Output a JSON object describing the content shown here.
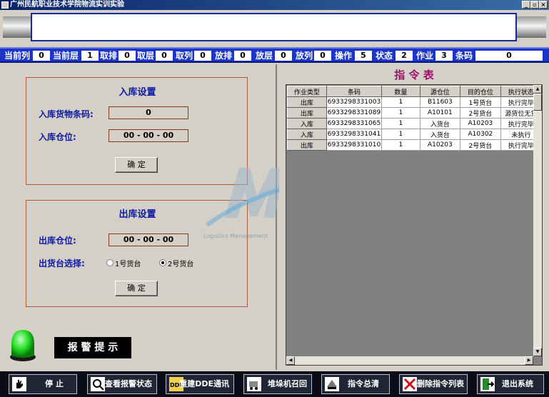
{
  "window": {
    "title": "广州民航职业技术学院物流实训实验",
    "min": "_",
    "max": "▫",
    "close": "×"
  },
  "status": [
    {
      "label": "当前列",
      "value": "0"
    },
    {
      "label": "当前层",
      "value": "1"
    },
    {
      "label": "取排",
      "value": "0"
    },
    {
      "label": "取层",
      "value": "0"
    },
    {
      "label": "取列",
      "value": "0"
    },
    {
      "label": "放排",
      "value": "0"
    },
    {
      "label": "放层",
      "value": "0"
    },
    {
      "label": "放列",
      "value": "0"
    },
    {
      "label": "操作",
      "value": "5"
    },
    {
      "label": "状态",
      "value": "2"
    },
    {
      "label": "作业",
      "value": "3"
    },
    {
      "label": "条码",
      "value": "0"
    }
  ],
  "inbound": {
    "title": "入库设置",
    "barcode_label": "入库货物条码:",
    "barcode_value": "0",
    "location_label": "入库仓位:",
    "location_value": "00 - 00 - 00",
    "confirm": "确  定"
  },
  "outbound": {
    "title": "出库设置",
    "location_label": "出库仓位:",
    "location_value": "00 - 00 - 00",
    "platform_label": "出货台选择:",
    "platform_options": [
      "1号货台",
      "2号货台"
    ],
    "platform_selected": 1,
    "confirm": "确  定"
  },
  "alarm": {
    "label": "报 警 提 示",
    "light_color": "#22dd22"
  },
  "command_table": {
    "title": "指 令 表",
    "headers": [
      "作业类型",
      "条码",
      "数量",
      "源仓位",
      "目的仓位",
      "执行状态"
    ],
    "rows": [
      [
        "出库",
        "6933298331003",
        "1",
        "B11603",
        "1号货台",
        "执行完毕"
      ],
      [
        "出库",
        "6933298331089",
        "1",
        "A10101",
        "2号货台",
        "源货位无货"
      ],
      [
        "入库",
        "6933298331065",
        "1",
        "入货台",
        "A10203",
        "执行完毕"
      ],
      [
        "入库",
        "6933298331041",
        "1",
        "入货台",
        "A10302",
        "未执行"
      ],
      [
        "出库",
        "6933298331010",
        "1",
        "A10203",
        "2号货台",
        "执行完毕"
      ]
    ]
  },
  "watermark": {
    "text": "Logistics Management"
  },
  "toolbar": [
    {
      "label": "停  止",
      "icon": "hand-stop-icon"
    },
    {
      "label": "查看报警状态",
      "icon": "alarm-view-icon"
    },
    {
      "label": "重建DDE通讯",
      "icon": "dde-icon"
    },
    {
      "label": "堆垛机召回",
      "icon": "stacker-recall-icon"
    },
    {
      "label": "指令总清",
      "icon": "clear-commands-icon"
    },
    {
      "label": "删除指令列表",
      "icon": "delete-icon"
    },
    {
      "label": "退出系统",
      "icon": "exit-icon"
    }
  ]
}
